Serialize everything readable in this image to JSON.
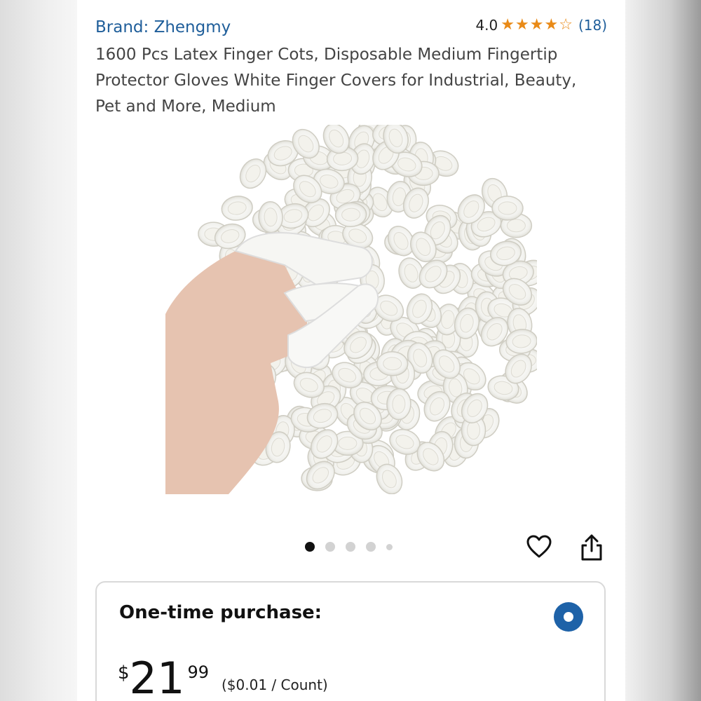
{
  "product": {
    "brand": "Brand: Zhengmy",
    "rating": "4.0",
    "rating_stars": 4,
    "rating_count": "(18)",
    "title": "1600 Pcs Latex Finger Cots, Disposable Medium Fingertip Protector Gloves White Finger Covers for Industrial, Beauty, Pet and More, Medium"
  },
  "carousel": {
    "total_dots": 5,
    "active_index": 0
  },
  "purchase": {
    "label": "One-time purchase:",
    "currency": "$",
    "price_whole": "21",
    "price_fraction": "99",
    "unit_price": "($0.01 / Count)"
  },
  "colors": {
    "link_blue": "#1f5e9a",
    "star_orange": "#e98a17",
    "radio_blue": "#1e62a8"
  },
  "icons": {
    "wishlist": "heart-outline-icon",
    "share": "share-icon",
    "star": "star-icon"
  }
}
